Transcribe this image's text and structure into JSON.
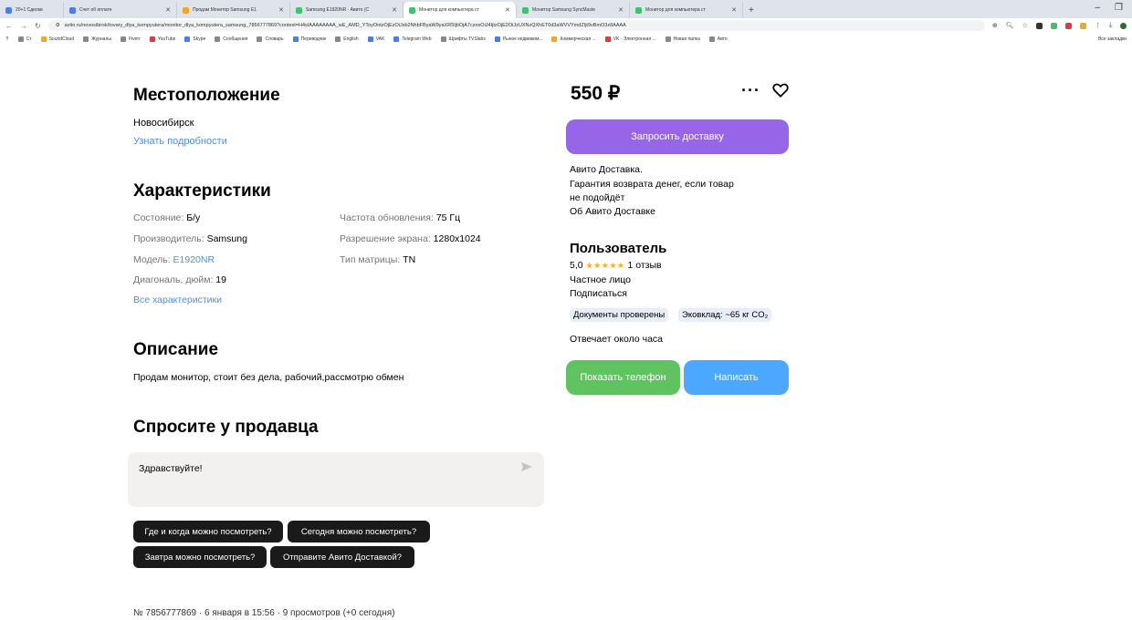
{
  "browser": {
    "tabs": [
      {
        "title": "20+1 Сделки",
        "color": "#4a7ef0"
      },
      {
        "title": "Счет об оплате",
        "color": "#4a7ef0"
      },
      {
        "title": "Продам Монитор Samsung E1",
        "color": "#f5a623"
      },
      {
        "title": "Samsung E1920NR · Авито (С",
        "color": "#3ec26b"
      },
      {
        "title": "Монитор для компьютера ст",
        "color": "#3ec26b"
      },
      {
        "title": "Монитор Samsung SyncMaste",
        "color": "#3ec26b"
      },
      {
        "title": "Монитор для компьютера ст",
        "color": "#3ec26b"
      }
    ],
    "new_tab": "+",
    "url": "avito.ru/novosibirsk/tovary_dlya_kompyutera/monitor_dlya_kompyutera_samsung_7856777869?context=H4sIAAAAAAAA_wE_AMD_YToyOntzOjEzOiJsb2NhbFByaW9yaXR5IjtiOjA7czoxOiJ4IjtzOjE2OiJzUXNzQXhET0d3aWVVYmdZIjt9vBmO3z8AAAA",
    "bookmarks": [
      "Ст",
      "SoundCloud",
      "Журналы",
      "Fiverr",
      "YouTube",
      "Skype",
      "Сообщения",
      "Словарь",
      "Переводчик",
      "English",
      "VAK",
      "Telegram Web",
      "Шрифты TVSlabs",
      "Рынок недвижим...",
      "Коммерческая ...",
      "VK - Электронная ...",
      "Новая папка",
      "Авто"
    ],
    "bookmarks_right": "Все закладки"
  },
  "location": {
    "title": "Местоположение",
    "city": "Новосибирск",
    "more_link": "Узнать подробности"
  },
  "characteristics": {
    "title": "Характеристики",
    "left": [
      {
        "label": "Состояние: ",
        "value": "Б/у",
        "link": false
      },
      {
        "label": "Производитель: ",
        "value": "Samsung",
        "link": false
      },
      {
        "label": "Модель: ",
        "value": "E1920NR",
        "link": true
      },
      {
        "label": "Диагональ, дюйм: ",
        "value": "19",
        "link": false
      }
    ],
    "right": [
      {
        "label": "Частота обновления: ",
        "value": "75 Гц"
      },
      {
        "label": "Разрешение экрана: ",
        "value": "1280x1024"
      },
      {
        "label": "Тип матрицы: ",
        "value": "TN"
      }
    ],
    "all_link": "Все характеристики"
  },
  "description": {
    "title": "Описание",
    "text": "Продам монитор, стоит без дела, рабочий,рассмотрю обмен"
  },
  "ask": {
    "title": "Спросите у продавца",
    "input_value": "Здравствуйте!",
    "chips": [
      "Где и когда можно посмотреть?",
      "Сегодня можно посмотреть?",
      "Завтра можно посмотреть?",
      "Отправите Авито Доставкой?"
    ]
  },
  "footer": "№ 7856777869 · 6 января в 15:56 · 9 просмотров (+0 сегодня)",
  "sidebar": {
    "price": "550 ₽",
    "more": "···",
    "delivery_button": "Запросить доставку",
    "delivery_lines": [
      "Авито Доставка.",
      "Гарантия возврата денег, если товар",
      "не подойдёт"
    ],
    "delivery_link": "Об Авито Доставке",
    "user_title": "Пользователь",
    "rating": "5,0",
    "stars": "★★★★★",
    "reviews": "1 отзыв",
    "person_type": "Частное лицо",
    "subscribe": "Подписаться",
    "badges": [
      "Документы проверены",
      "Эковклад: ~65 кг CO₂"
    ],
    "response_time": "Отвечает около часа",
    "phone_button": "Показать телефон",
    "write_button": "Написать"
  },
  "colors": {
    "accent_purple": "#9665e8",
    "green": "#5fc45f",
    "blue": "#4ba7ff",
    "link": "#4b8ef0",
    "star": "#ffb021"
  }
}
